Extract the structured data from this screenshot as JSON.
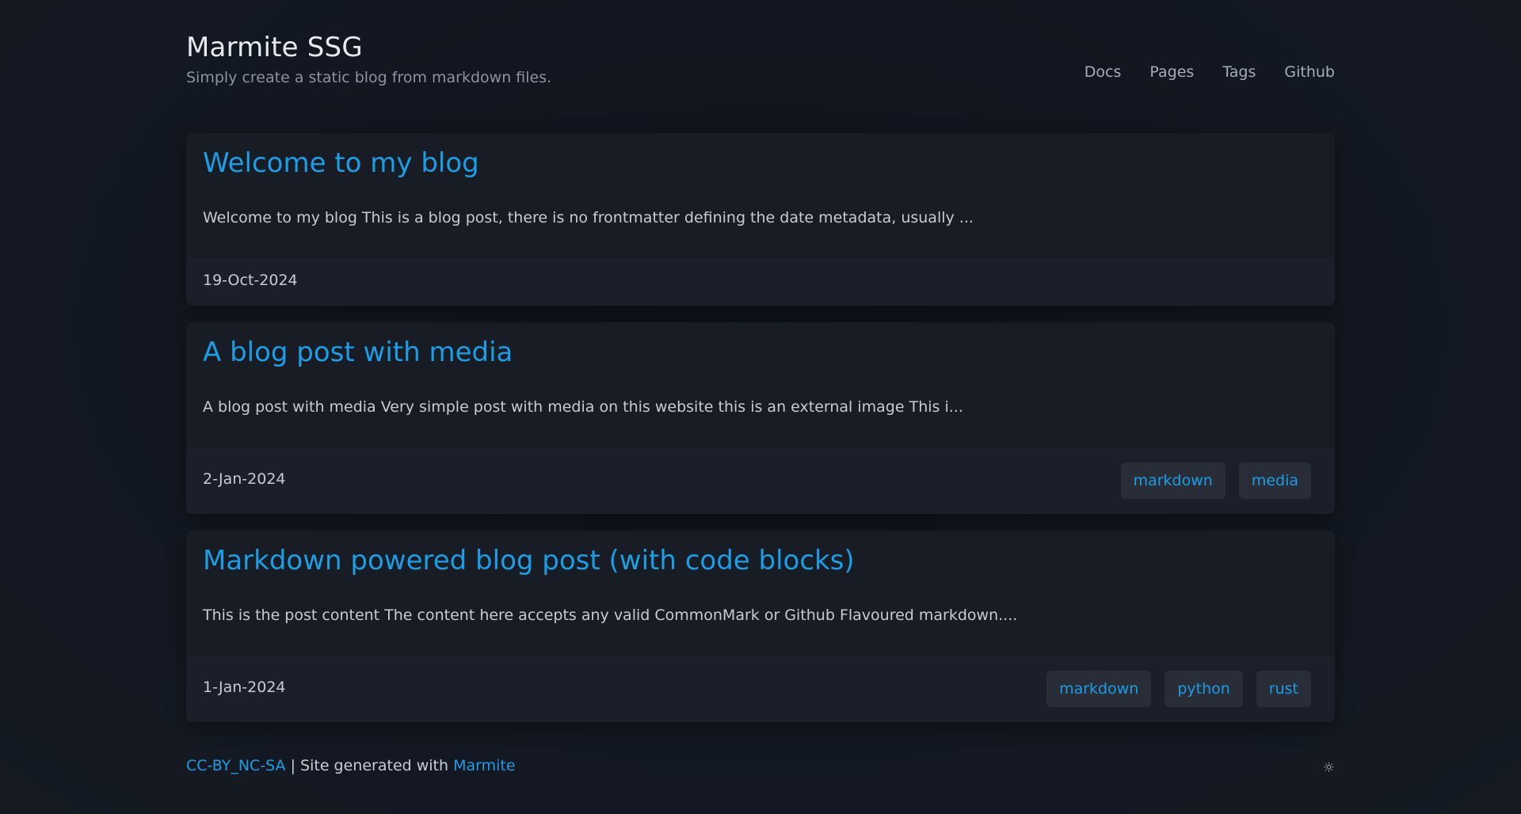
{
  "site": {
    "title": "Marmite SSG",
    "tagline": "Simply create a static blog from markdown files."
  },
  "nav": {
    "items": [
      {
        "label": "Docs"
      },
      {
        "label": "Pages"
      },
      {
        "label": "Tags"
      },
      {
        "label": "Github"
      }
    ]
  },
  "posts": [
    {
      "title": "Welcome to my blog",
      "excerpt": "Welcome to my blog This is a blog post, there is no frontmatter defining the date metadata, usually ...",
      "date": "19-Oct-2024",
      "tags": []
    },
    {
      "title": "A blog post with media",
      "excerpt": "A blog post with media Very simple post with media on this website this is an external image This i...",
      "date": "2-Jan-2024",
      "tags": [
        "markdown",
        "media"
      ]
    },
    {
      "title": "Markdown powered blog post (with code blocks)",
      "excerpt": "This is the post content The content here accepts any valid CommonMark or Github Flavoured markdown....",
      "date": "1-Jan-2024",
      "tags": [
        "markdown",
        "python",
        "rust"
      ]
    }
  ],
  "footer": {
    "license_link": "CC-BY_NC-SA",
    "separator_text": " | Site generated with ",
    "generator_link": "Marmite",
    "theme_toggle_icon": "☼"
  },
  "colors": {
    "accent": "#1a9ee6",
    "background": "#11161f",
    "card": "#181c25",
    "card_footer": "#1a1f29",
    "tag_bg": "#282d38"
  }
}
